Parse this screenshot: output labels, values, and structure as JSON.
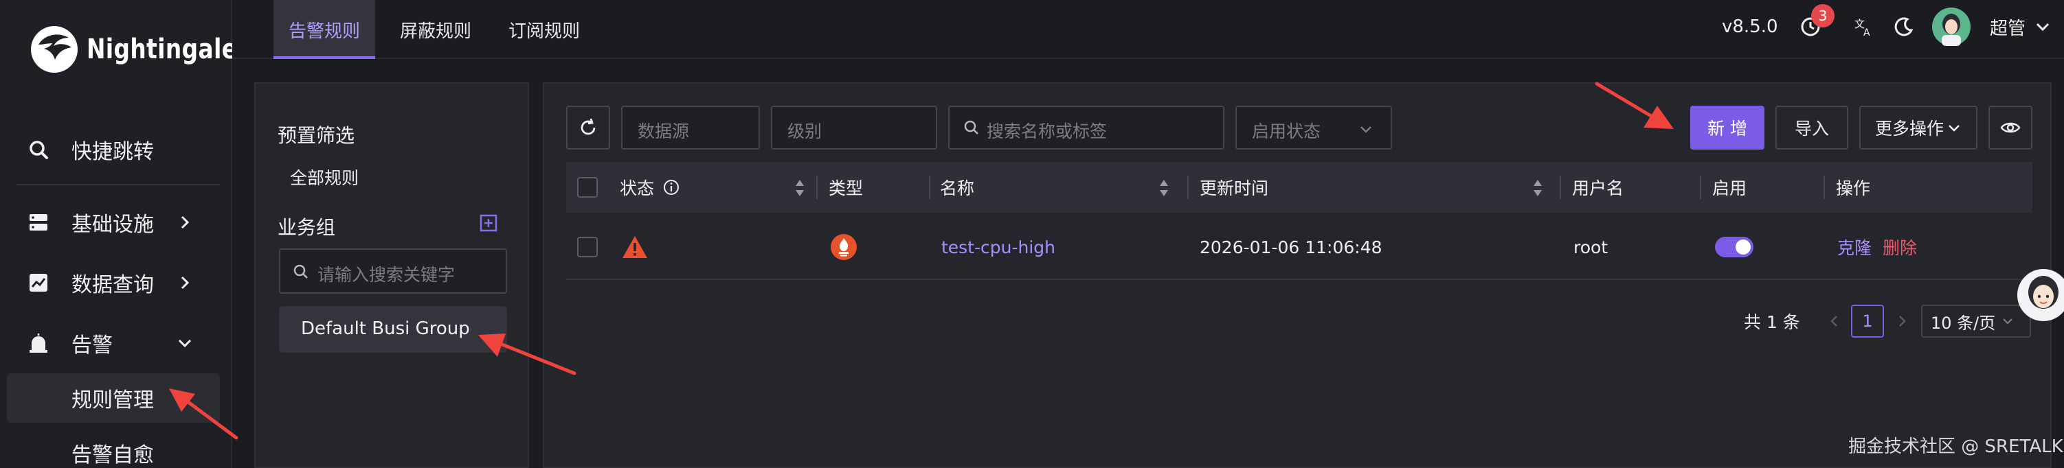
{
  "app": {
    "name": "Nightingale"
  },
  "nav": {
    "items": [
      {
        "label": "快捷跳转",
        "icon": "search-icon"
      },
      {
        "label": "基础设施",
        "icon": "server-icon"
      },
      {
        "label": "数据查询",
        "icon": "chart-icon"
      },
      {
        "label": "告警",
        "icon": "alarm-icon"
      }
    ],
    "sub_items": [
      {
        "label": "规则管理",
        "active": true
      },
      {
        "label": "告警自愈",
        "active": false
      }
    ]
  },
  "header": {
    "tabs": [
      {
        "label": "告警规则",
        "active": true
      },
      {
        "label": "屏蔽规则",
        "active": false
      },
      {
        "label": "订阅规则",
        "active": false
      }
    ],
    "version": "v8.5.0",
    "notification_count": "3",
    "user": "超管"
  },
  "filter": {
    "preset_title": "预置筛选",
    "all_rules": "全部规则",
    "group_title": "业务组",
    "search_placeholder": "请输入搜索关键字",
    "groups": [
      "Default Busi Group"
    ]
  },
  "toolbar": {
    "datasource_placeholder": "数据源",
    "level_placeholder": "级别",
    "search_placeholder": "搜索名称或标签",
    "status_placeholder": "启用状态",
    "add_label": "新 增",
    "import_label": "导入",
    "more_label": "更多操作"
  },
  "table": {
    "columns": [
      "状态",
      "类型",
      "名称",
      "更新时间",
      "用户名",
      "启用",
      "操作"
    ],
    "rows": [
      {
        "status": "warning",
        "type": "prometheus",
        "name": "test-cpu-high",
        "updated": "2026-01-06 11:06:48",
        "user": "root",
        "enabled": true,
        "actions": [
          "克隆",
          "删除"
        ]
      }
    ]
  },
  "pagination": {
    "total": "共 1 条",
    "current": "1",
    "page_size": "10 条/页"
  },
  "watermark": "掘金技术社区 @ SRETALK",
  "colors": {
    "accent": "#7b5ce6",
    "danger": "#ef5b6b",
    "warning": "#e8502f",
    "bg": "#1b1c21"
  }
}
